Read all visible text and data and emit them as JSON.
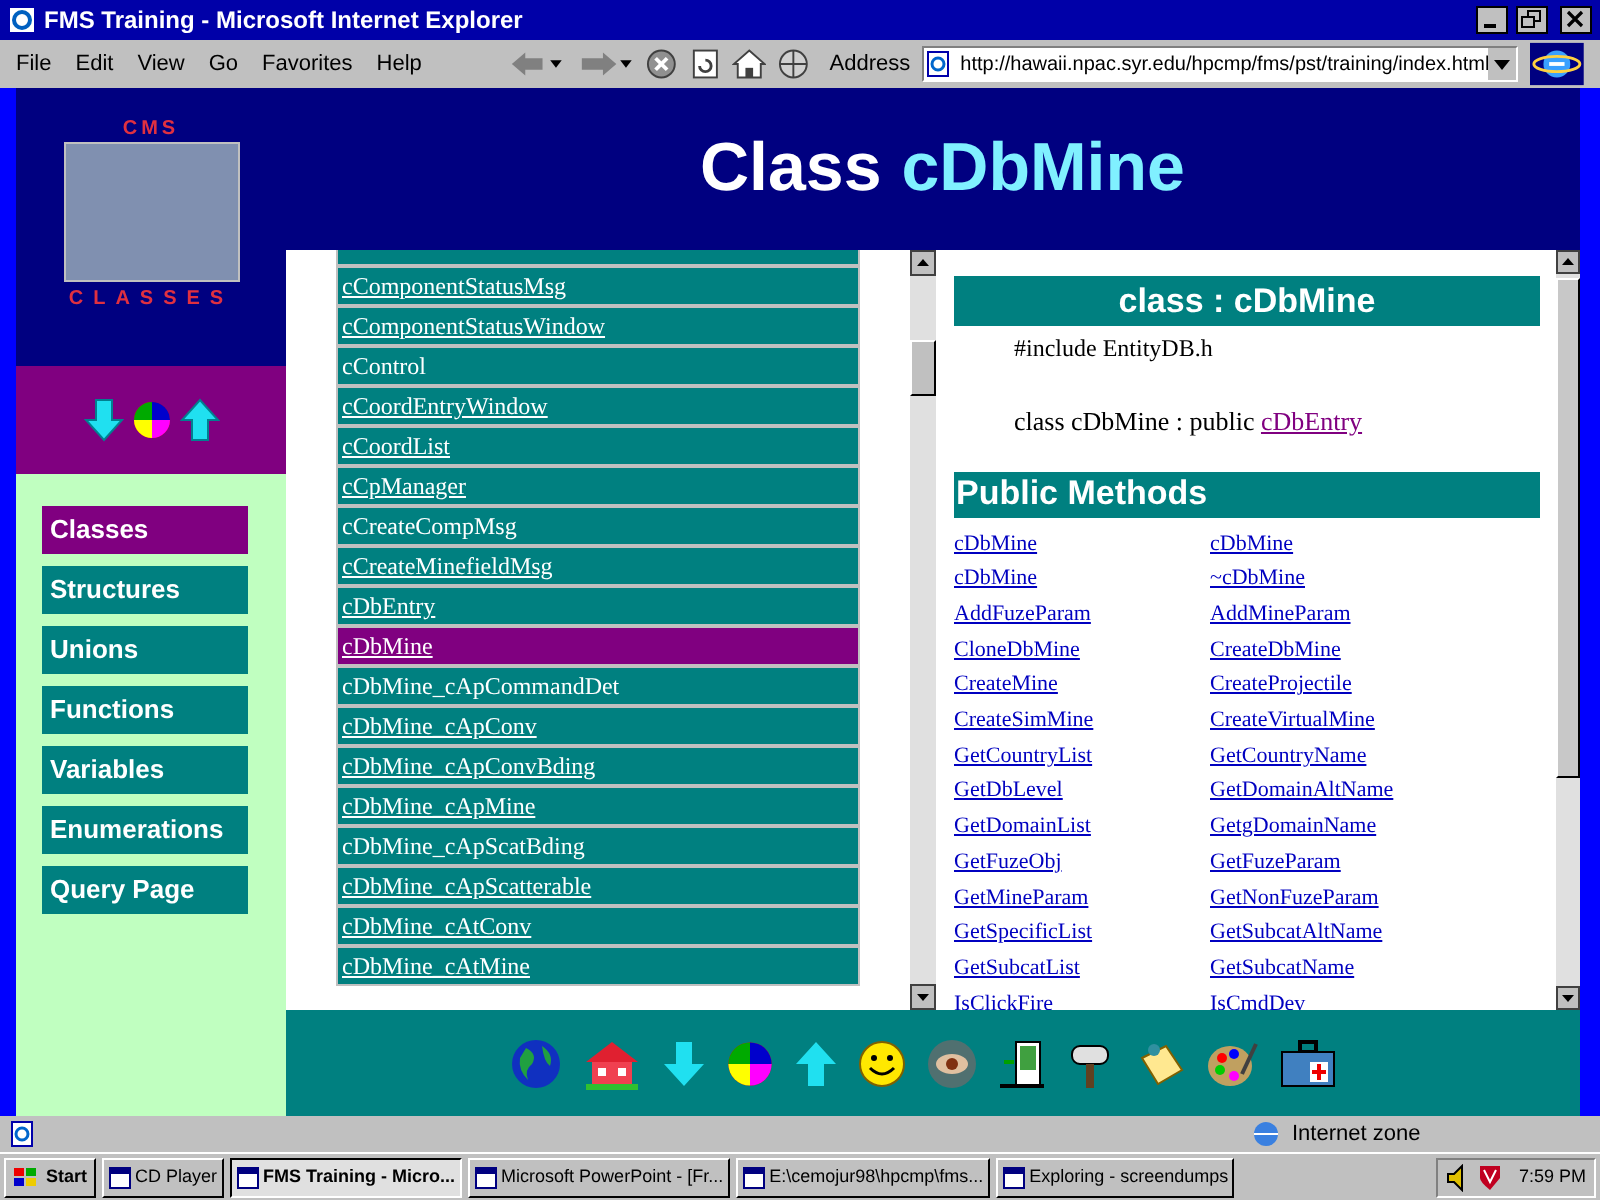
{
  "window": {
    "title": "FMS Training - Microsoft Internet Explorer"
  },
  "menu": [
    "File",
    "Edit",
    "View",
    "Go",
    "Favorites",
    "Help"
  ],
  "address": {
    "label": "Address",
    "value": "http://hawaii.npac.syr.edu/hpcmp/fms/pst/training/index.html"
  },
  "logo": {
    "top": "CMS",
    "bottom": "CLASSES"
  },
  "nav": [
    {
      "label": "Classes",
      "selected": true
    },
    {
      "label": "Structures",
      "selected": false
    },
    {
      "label": "Unions",
      "selected": false
    },
    {
      "label": "Functions",
      "selected": false
    },
    {
      "label": "Variables",
      "selected": false
    },
    {
      "label": "Enumerations",
      "selected": false
    },
    {
      "label": "Query Page",
      "selected": false
    }
  ],
  "header": {
    "prefix": "Class",
    "name": "cDbMine"
  },
  "class_list": [
    {
      "label": "cComponentStatusMsg",
      "selected": false,
      "link": true
    },
    {
      "label": "cComponentStatusWindow",
      "selected": false,
      "link": true
    },
    {
      "label": "cControl",
      "selected": false,
      "link": false
    },
    {
      "label": "cCoordEntryWindow",
      "selected": false,
      "link": true
    },
    {
      "label": "cCoordList",
      "selected": false,
      "link": true
    },
    {
      "label": "cCpManager",
      "selected": false,
      "link": true
    },
    {
      "label": "cCreateCompMsg",
      "selected": false,
      "link": false
    },
    {
      "label": "cCreateMinefieldMsg",
      "selected": false,
      "link": true
    },
    {
      "label": "cDbEntry",
      "selected": false,
      "link": true
    },
    {
      "label": "cDbMine",
      "selected": true,
      "link": true
    },
    {
      "label": "cDbMine_cApCommandDet",
      "selected": false,
      "link": false
    },
    {
      "label": "cDbMine_cApConv",
      "selected": false,
      "link": true
    },
    {
      "label": "cDbMine_cApConvBding",
      "selected": false,
      "link": true
    },
    {
      "label": "cDbMine_cApMine",
      "selected": false,
      "link": true
    },
    {
      "label": "cDbMine_cApScatBding",
      "selected": false,
      "link": false
    },
    {
      "label": "cDbMine_cApScatterable",
      "selected": false,
      "link": true
    },
    {
      "label": "cDbMine_cAtConv",
      "selected": false,
      "link": true
    },
    {
      "label": "cDbMine_cAtMine",
      "selected": false,
      "link": true
    }
  ],
  "detail": {
    "heading": "class : cDbMine",
    "include": "#include EntityDB.h",
    "declaration": "class cDbMine : public",
    "base_class": "cDbEntry",
    "section": "Public Methods",
    "methods": [
      [
        "cDbMine",
        "cDbMine"
      ],
      [
        "cDbMine",
        "~cDbMine"
      ],
      [
        "AddFuzeParam",
        "AddMineParam"
      ],
      [
        "CloneDbMine",
        "CreateDbMine"
      ],
      [
        "CreateMine",
        "CreateProjectile"
      ],
      [
        "CreateSimMine",
        "CreateVirtualMine"
      ],
      [
        "GetCountryList",
        "GetCountryName"
      ],
      [
        "GetDbLevel",
        "GetDomainAltName"
      ],
      [
        "GetDomainList",
        "GetgDomainName"
      ],
      [
        "GetFuzeObj",
        "GetFuzeParam"
      ],
      [
        "GetMineParam",
        "GetNonFuzeParam"
      ],
      [
        "GetSpecificList",
        "GetSubcatAltName"
      ],
      [
        "GetSubcatList",
        "GetSubcatName"
      ],
      [
        "IsClickFire",
        "IsCmdDev"
      ]
    ]
  },
  "status_bar": {
    "zone": "Internet zone"
  },
  "taskbar": {
    "start": "Start",
    "tasks": [
      {
        "label": "CD Player",
        "selected": false
      },
      {
        "label": "FMS Training - Micro...",
        "selected": true
      },
      {
        "label": "Microsoft PowerPoint - [Fr...",
        "selected": false
      },
      {
        "label": "E:\\cemojur98\\hpcmp\\fms...",
        "selected": false
      },
      {
        "label": "Exploring - screendumps",
        "selected": false
      }
    ],
    "clock": "7:59 PM"
  }
}
